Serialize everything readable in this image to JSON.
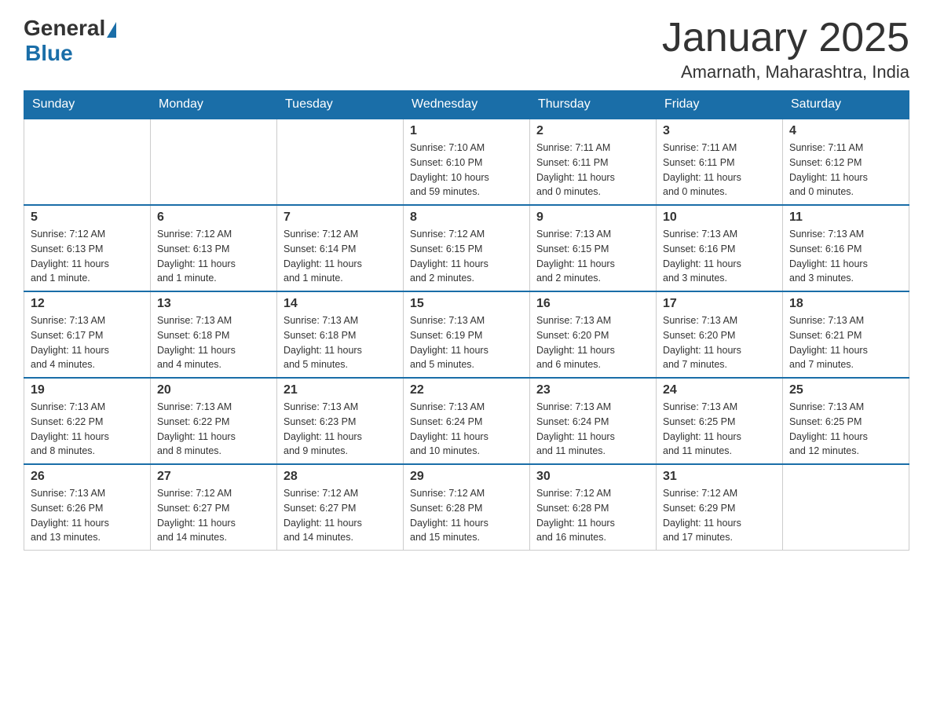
{
  "header": {
    "logo_general": "General",
    "logo_blue": "Blue",
    "month_title": "January 2025",
    "location": "Amarnath, Maharashtra, India"
  },
  "days_of_week": [
    "Sunday",
    "Monday",
    "Tuesday",
    "Wednesday",
    "Thursday",
    "Friday",
    "Saturday"
  ],
  "weeks": [
    [
      {
        "day": "",
        "info": ""
      },
      {
        "day": "",
        "info": ""
      },
      {
        "day": "",
        "info": ""
      },
      {
        "day": "1",
        "info": "Sunrise: 7:10 AM\nSunset: 6:10 PM\nDaylight: 10 hours\nand 59 minutes."
      },
      {
        "day": "2",
        "info": "Sunrise: 7:11 AM\nSunset: 6:11 PM\nDaylight: 11 hours\nand 0 minutes."
      },
      {
        "day": "3",
        "info": "Sunrise: 7:11 AM\nSunset: 6:11 PM\nDaylight: 11 hours\nand 0 minutes."
      },
      {
        "day": "4",
        "info": "Sunrise: 7:11 AM\nSunset: 6:12 PM\nDaylight: 11 hours\nand 0 minutes."
      }
    ],
    [
      {
        "day": "5",
        "info": "Sunrise: 7:12 AM\nSunset: 6:13 PM\nDaylight: 11 hours\nand 1 minute."
      },
      {
        "day": "6",
        "info": "Sunrise: 7:12 AM\nSunset: 6:13 PM\nDaylight: 11 hours\nand 1 minute."
      },
      {
        "day": "7",
        "info": "Sunrise: 7:12 AM\nSunset: 6:14 PM\nDaylight: 11 hours\nand 1 minute."
      },
      {
        "day": "8",
        "info": "Sunrise: 7:12 AM\nSunset: 6:15 PM\nDaylight: 11 hours\nand 2 minutes."
      },
      {
        "day": "9",
        "info": "Sunrise: 7:13 AM\nSunset: 6:15 PM\nDaylight: 11 hours\nand 2 minutes."
      },
      {
        "day": "10",
        "info": "Sunrise: 7:13 AM\nSunset: 6:16 PM\nDaylight: 11 hours\nand 3 minutes."
      },
      {
        "day": "11",
        "info": "Sunrise: 7:13 AM\nSunset: 6:16 PM\nDaylight: 11 hours\nand 3 minutes."
      }
    ],
    [
      {
        "day": "12",
        "info": "Sunrise: 7:13 AM\nSunset: 6:17 PM\nDaylight: 11 hours\nand 4 minutes."
      },
      {
        "day": "13",
        "info": "Sunrise: 7:13 AM\nSunset: 6:18 PM\nDaylight: 11 hours\nand 4 minutes."
      },
      {
        "day": "14",
        "info": "Sunrise: 7:13 AM\nSunset: 6:18 PM\nDaylight: 11 hours\nand 5 minutes."
      },
      {
        "day": "15",
        "info": "Sunrise: 7:13 AM\nSunset: 6:19 PM\nDaylight: 11 hours\nand 5 minutes."
      },
      {
        "day": "16",
        "info": "Sunrise: 7:13 AM\nSunset: 6:20 PM\nDaylight: 11 hours\nand 6 minutes."
      },
      {
        "day": "17",
        "info": "Sunrise: 7:13 AM\nSunset: 6:20 PM\nDaylight: 11 hours\nand 7 minutes."
      },
      {
        "day": "18",
        "info": "Sunrise: 7:13 AM\nSunset: 6:21 PM\nDaylight: 11 hours\nand 7 minutes."
      }
    ],
    [
      {
        "day": "19",
        "info": "Sunrise: 7:13 AM\nSunset: 6:22 PM\nDaylight: 11 hours\nand 8 minutes."
      },
      {
        "day": "20",
        "info": "Sunrise: 7:13 AM\nSunset: 6:22 PM\nDaylight: 11 hours\nand 8 minutes."
      },
      {
        "day": "21",
        "info": "Sunrise: 7:13 AM\nSunset: 6:23 PM\nDaylight: 11 hours\nand 9 minutes."
      },
      {
        "day": "22",
        "info": "Sunrise: 7:13 AM\nSunset: 6:24 PM\nDaylight: 11 hours\nand 10 minutes."
      },
      {
        "day": "23",
        "info": "Sunrise: 7:13 AM\nSunset: 6:24 PM\nDaylight: 11 hours\nand 11 minutes."
      },
      {
        "day": "24",
        "info": "Sunrise: 7:13 AM\nSunset: 6:25 PM\nDaylight: 11 hours\nand 11 minutes."
      },
      {
        "day": "25",
        "info": "Sunrise: 7:13 AM\nSunset: 6:25 PM\nDaylight: 11 hours\nand 12 minutes."
      }
    ],
    [
      {
        "day": "26",
        "info": "Sunrise: 7:13 AM\nSunset: 6:26 PM\nDaylight: 11 hours\nand 13 minutes."
      },
      {
        "day": "27",
        "info": "Sunrise: 7:12 AM\nSunset: 6:27 PM\nDaylight: 11 hours\nand 14 minutes."
      },
      {
        "day": "28",
        "info": "Sunrise: 7:12 AM\nSunset: 6:27 PM\nDaylight: 11 hours\nand 14 minutes."
      },
      {
        "day": "29",
        "info": "Sunrise: 7:12 AM\nSunset: 6:28 PM\nDaylight: 11 hours\nand 15 minutes."
      },
      {
        "day": "30",
        "info": "Sunrise: 7:12 AM\nSunset: 6:28 PM\nDaylight: 11 hours\nand 16 minutes."
      },
      {
        "day": "31",
        "info": "Sunrise: 7:12 AM\nSunset: 6:29 PM\nDaylight: 11 hours\nand 17 minutes."
      },
      {
        "day": "",
        "info": ""
      }
    ]
  ]
}
